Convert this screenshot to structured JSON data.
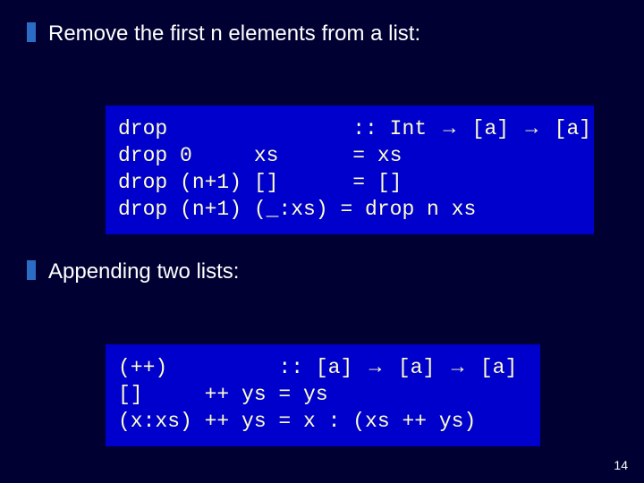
{
  "bullets": {
    "b1": "Remove the first n elements from a list:",
    "b2": "Appending two lists:"
  },
  "code1": {
    "l1a": "drop               :: Int ",
    "l1b": " [a] ",
    "l1c": " [a]",
    "l2": "drop 0     xs      = xs",
    "l3": "drop (n+1) []      = []",
    "l4": "drop (n+1) (_:xs) = drop n xs"
  },
  "code2": {
    "l1a": "(++)         :: [a] ",
    "l1b": " [a] ",
    "l1c": " [a]",
    "l2": "[]     ++ ys = ys",
    "l3": "(x:xs) ++ ys = x : (xs ++ ys)"
  },
  "glyphs": {
    "arrow": "→"
  },
  "page": "14",
  "chart_data": null
}
